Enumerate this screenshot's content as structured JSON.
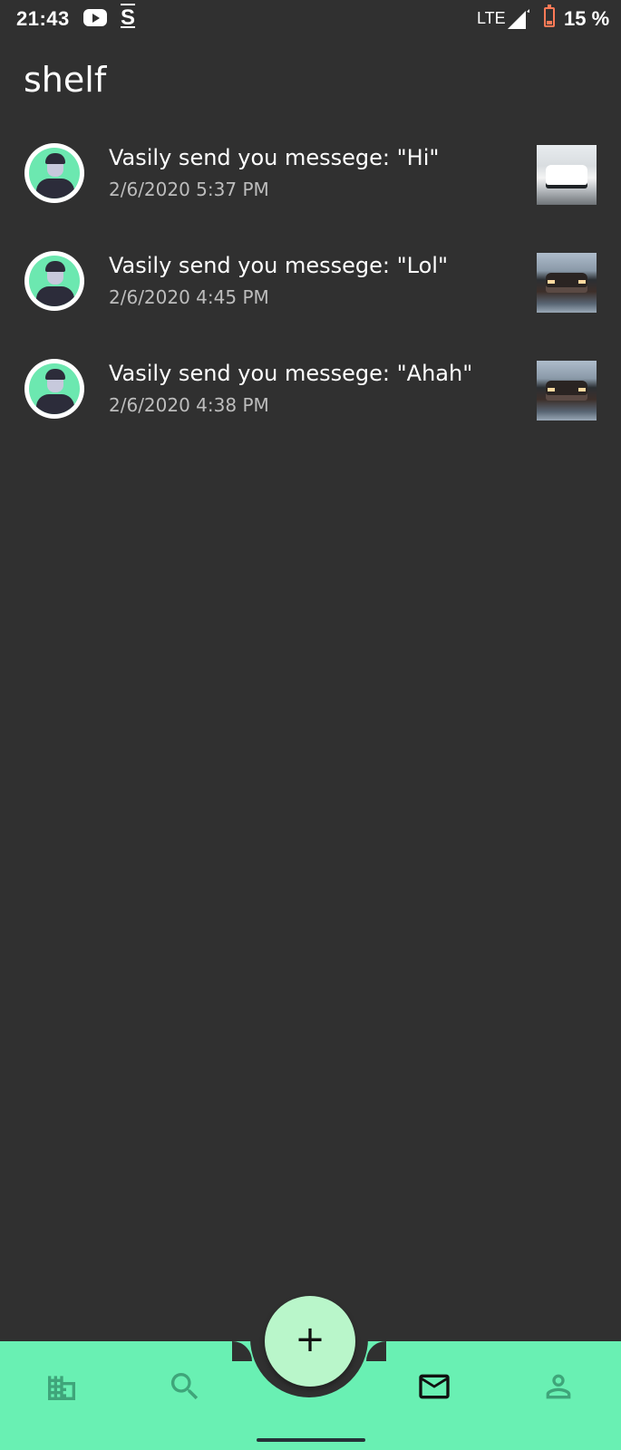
{
  "status_bar": {
    "time": "21:43",
    "network": "LTE",
    "battery": "15 %",
    "icons": [
      "youtube-icon",
      "s-icon",
      "signal-icon",
      "battery-icon"
    ]
  },
  "page": {
    "title": "shelf"
  },
  "notifications": [
    {
      "text": "Vasily send you messege: \"Hi\"",
      "time": "2/6/2020 5:37 PM",
      "thumbnail": "white-car"
    },
    {
      "text": "Vasily send you messege: \"Lol\"",
      "time": "2/6/2020 4:45 PM",
      "thumbnail": "dark-truck"
    },
    {
      "text": "Vasily send you messege: \"Ahah\"",
      "time": "2/6/2020 4:38 PM",
      "thumbnail": "dark-truck"
    }
  ],
  "bottom_nav": {
    "items": [
      {
        "name": "buildings-icon",
        "active": false
      },
      {
        "name": "search-icon",
        "active": false
      },
      {
        "name": "mail-icon",
        "active": true
      },
      {
        "name": "person-icon",
        "active": false
      }
    ],
    "fab_icon": "+"
  },
  "colors": {
    "background": "#303030",
    "accent": "#69f0b3",
    "fab": "#b9f6ca",
    "nav_inactive": "#3fa57a",
    "nav_active": "#111111",
    "battery": "#ff7a57"
  }
}
